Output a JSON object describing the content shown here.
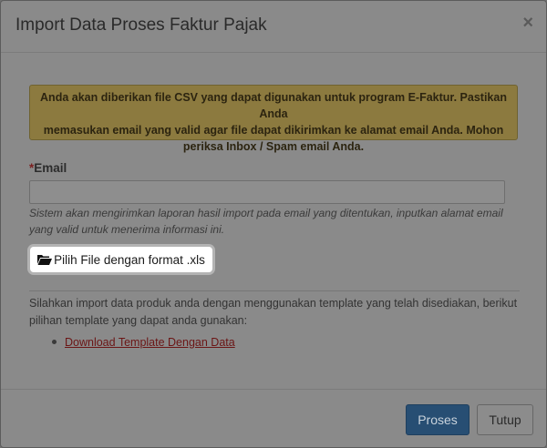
{
  "modal": {
    "title": "Import Data Proses Faktur Pajak",
    "close_label": "×"
  },
  "alert": {
    "line1": "Anda akan diberikan file CSV yang dapat digunakan untuk program E-Faktur. Pastikan Anda",
    "line2": "memasukan email yang valid agar file dapat dikirimkan ke alamat email Anda. Mohon",
    "line3": "periksa Inbox / Spam email Anda."
  },
  "email_field": {
    "required_mark": "*",
    "label": "Email",
    "value": "",
    "placeholder": "",
    "help_line1": "Sistem akan mengirimkan laporan hasil import pada email yang ditentukan, inputkan alamat email",
    "help_line2": "yang valid untuk menerima informasi ini."
  },
  "file_button": {
    "icon": "folder-open-icon",
    "label": "Pilih File dengan format .xls"
  },
  "template_info": {
    "line1": "Silahkan import data produk anda dengan menggunakan template yang telah disediakan, berikut",
    "line2": "pilihan template yang dapat anda gunakan:",
    "links": [
      "Download Template Dengan Data"
    ]
  },
  "footer": {
    "proses_label": "Proses",
    "tutup_label": "Tutup"
  },
  "colors": {
    "primary": "#274e73",
    "alert_bg": "#8c7a3f",
    "link": "#6b1515",
    "overlay": "#6f6f6f"
  }
}
